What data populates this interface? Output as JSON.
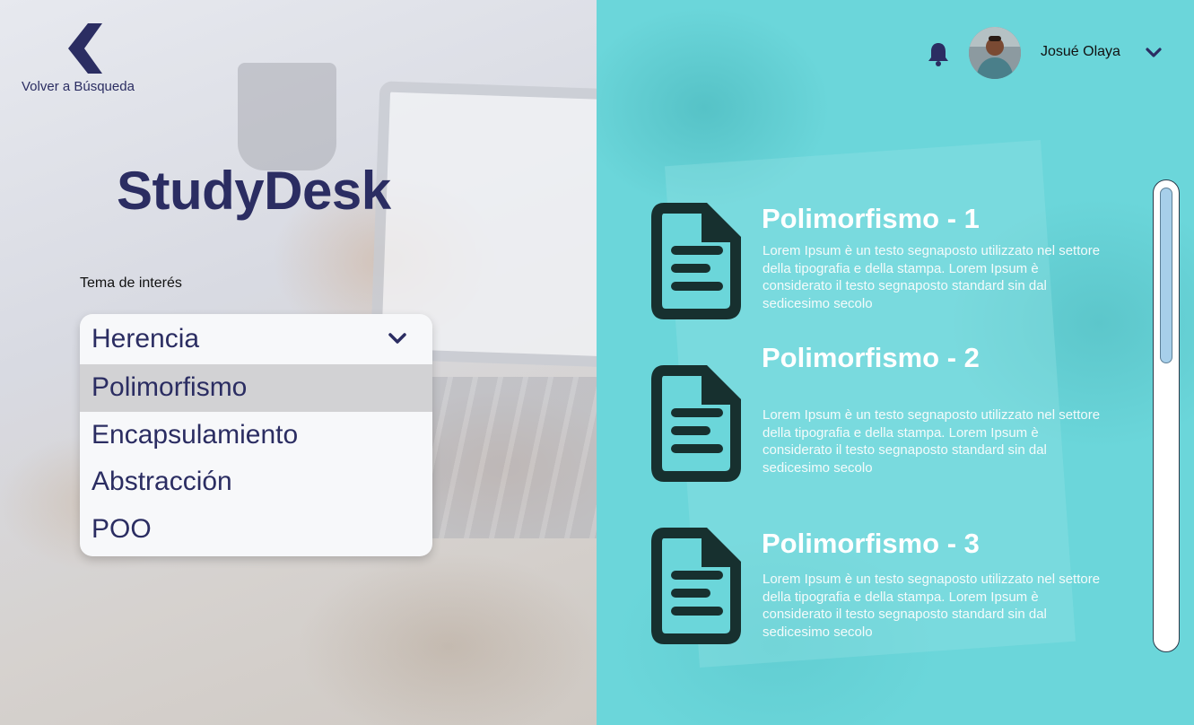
{
  "nav": {
    "back_label": "Volver a Búsqueda",
    "back_icon": "chevron-left-icon"
  },
  "brand": {
    "name": "StudyDesk"
  },
  "topic": {
    "label": "Tema de interés",
    "selected": "Herencia",
    "options": [
      "Polimorfismo",
      "Encapsulamiento",
      "Abstracción",
      "POO"
    ],
    "hovered": "Polimorfismo"
  },
  "header": {
    "user_name": "Josué Olaya",
    "icons": [
      "bell-icon",
      "avatar",
      "chevron-down-icon"
    ]
  },
  "results": [
    {
      "title": "Polimorfismo - 1",
      "description": "Lorem Ipsum è un testo segnaposto utilizzato nel settore della tipografia e della stampa. Lorem Ipsum è considerato il testo segnaposto standard sin dal sedicesimo secolo"
    },
    {
      "title": "Polimorfismo - 2",
      "description": "Lorem Ipsum è un testo segnaposto utilizzato nel settore della tipografia e della stampa. Lorem Ipsum è considerato il testo segnaposto standard sin dal sedicesimo secolo"
    },
    {
      "title": "Polimorfismo - 3",
      "description": "Lorem Ipsum è un testo segnaposto utilizzato nel settore della tipografia e della stampa. Lorem Ipsum è considerato il testo segnaposto standard sin dal sedicesimo secolo"
    }
  ],
  "colors": {
    "brand": "#2b2d62",
    "teal": "#6bd6da",
    "icon_dark": "#17302f",
    "dropdown_hover": "#d2d2d4"
  }
}
